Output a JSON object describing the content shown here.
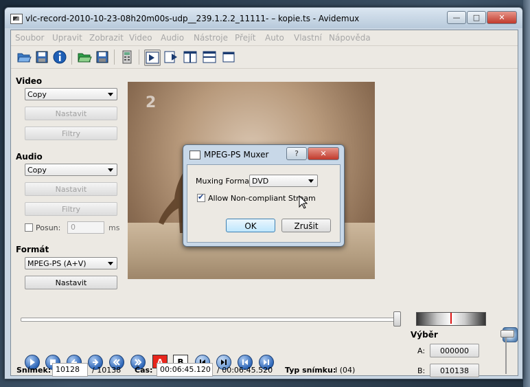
{
  "window": {
    "title": "vlc-record-2010-10-23-08h20m00s-udp__239.1.2.2_11111- – kopie.ts - Avidemux",
    "controls": {
      "minimize": "—",
      "maximize": "□",
      "close": "✕"
    }
  },
  "menu": [
    "Soubor",
    "Upravit",
    "Zobrazit",
    "Video",
    "Audio",
    "Nástroje",
    "Přejít",
    "Auto",
    "Vlastní",
    "Nápověda"
  ],
  "toolbar": {
    "icons": [
      "open-folder-icon",
      "save-icon",
      "info-icon",
      "open-video-icon",
      "save-video-icon",
      "calculator-icon",
      "input-view-icon",
      "output-view-icon",
      "side-by-side-icon",
      "top-bottom-icon",
      "separate-window-icon"
    ]
  },
  "video": {
    "label": "Video",
    "codec": "Copy",
    "configure": "Nastavit",
    "filters": "Filtry"
  },
  "audio": {
    "label": "Audio",
    "codec": "Copy",
    "configure": "Nastavit",
    "filters": "Filtry",
    "shift_label": "Posun:",
    "shift_value": "0",
    "shift_unit": "ms"
  },
  "format": {
    "label": "Formát",
    "value": "MPEG-PS (A+V)",
    "configure": "Nastavit"
  },
  "dialog": {
    "title": "MPEG-PS Muxer",
    "help": "?",
    "close": "✕",
    "muxing_label": "Muxing Format",
    "muxing_value": "DVD",
    "allow_label": "Allow Non-compliant Stream",
    "ok": "OK",
    "cancel": "Zrušit"
  },
  "transport": {
    "marker_a": "A",
    "marker_b": "B"
  },
  "status": {
    "frame_label": "Snímek:",
    "frame_value": "10128",
    "frame_total": "/ 10138",
    "time_label": "Čas:",
    "time_value": "00:06:45.120",
    "time_total": "/ 00:06:45.520",
    "frame_type_label": "Typ snímku:",
    "frame_type_value": "I (04)"
  },
  "selection": {
    "label": "Výběr",
    "a_label": "A:",
    "a_value": "000000",
    "b_label": "B:",
    "b_value": "010138"
  },
  "colors": {
    "accent": "#2f67b8",
    "marker_red": "#e8261c"
  }
}
